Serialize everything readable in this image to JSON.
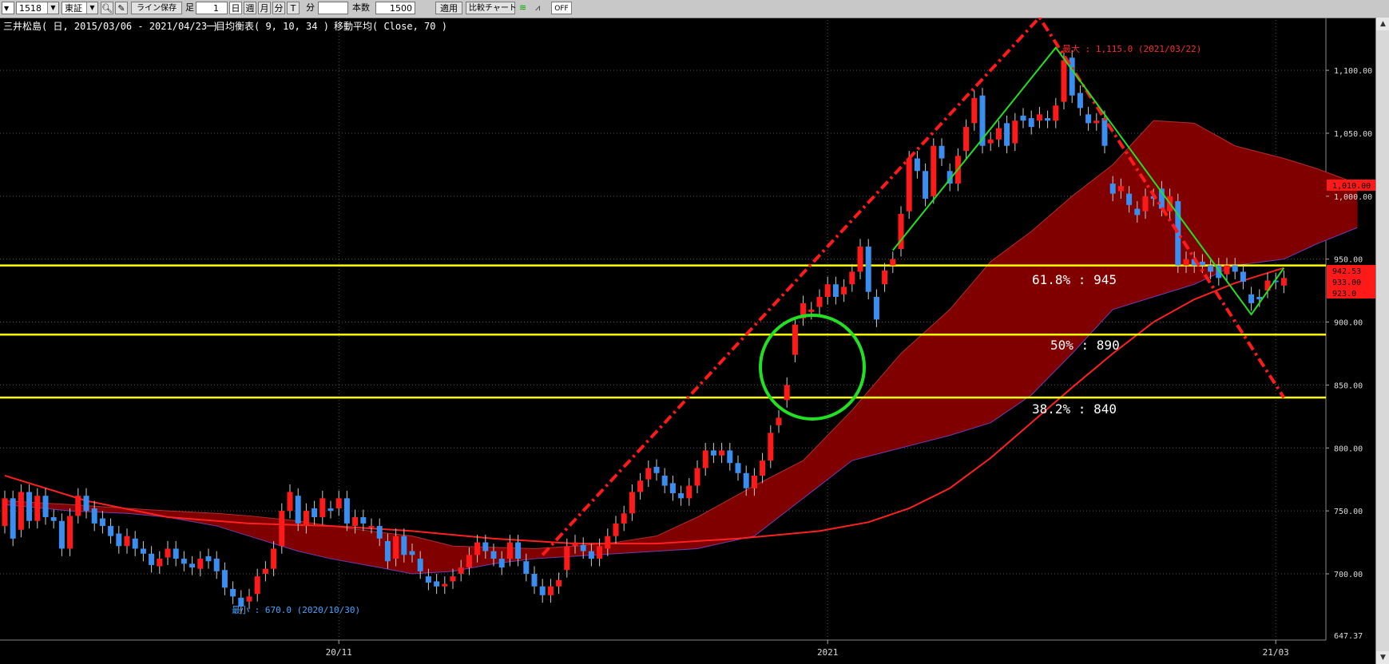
{
  "toolbar": {
    "code": "1518",
    "exchange": "東証",
    "save_label": "ライン保存",
    "ashi_label": "足",
    "period_value": "1",
    "day_label": "日",
    "week_label": "週",
    "month_label": "月",
    "minute_label": "分",
    "tick_label": "T",
    "minute2_label": "分",
    "count_label": "本数",
    "count_value": "1500",
    "apply_label": "適用",
    "compare_label": "比較チャート",
    "off_label": "OFF"
  },
  "header": {
    "title": "三井松島( 日, 2015/03/06 - 2021/04/23 )",
    "ichimoku": "一目均衡表( 9, 10, 34 )",
    "ma": "移動平均( Close, 70 )"
  },
  "annotations": {
    "max": "最大 : 1,115.0 (2021/03/22)",
    "min": "最小 : 670.0 (2020/10/30)",
    "fib618": "61.8% : 945",
    "fib50": "50% : 890",
    "fib382": "38.2% : 840"
  },
  "price_tags": {
    "a": "1,010.00",
    "b": "942.53",
    "c": "933.00",
    "d": "923.0"
  },
  "colors": {
    "up": "#ff1a1a",
    "down": "#3a8ef0",
    "yellow": "#ffff00",
    "green": "#22e022",
    "red_line": "#ff1a1a",
    "kumo_red": "#800000",
    "kumo_blue": "#1c1c95",
    "grid": "#555555",
    "ma": "#ff2020"
  },
  "chart_data": {
    "type": "candlestick",
    "ylim": [
      647.37,
      1140
    ],
    "y_ticks": [
      "700.00",
      "750.00",
      "800.00",
      "850.00",
      "900.00",
      "950.00",
      "1,000.00",
      "1,050.00",
      "1,100.00"
    ],
    "y_tick_values": [
      700,
      750,
      800,
      850,
      900,
      950,
      1000,
      1050,
      1100
    ],
    "bottom_label": "647.37",
    "x_labels": [
      {
        "label": "20/11",
        "index": 41
      },
      {
        "label": "2021",
        "index": 101
      },
      {
        "label": "21/03",
        "index": 156
      }
    ],
    "fib_levels": [
      945,
      890,
      840
    ],
    "candles": [
      [
        0,
        738,
        760
      ],
      [
        1,
        760,
        728
      ],
      [
        2,
        735,
        765
      ],
      [
        3,
        765,
        742
      ],
      [
        4,
        742,
        762
      ],
      [
        5,
        762,
        745
      ],
      [
        6,
        745,
        742
      ],
      [
        7,
        742,
        720
      ],
      [
        8,
        720,
        746
      ],
      [
        9,
        746,
        762
      ],
      [
        10,
        762,
        750
      ],
      [
        11,
        752,
        740
      ],
      [
        12,
        744,
        738
      ],
      [
        13,
        738,
        730
      ],
      [
        14,
        732,
        722
      ],
      [
        15,
        722,
        730
      ],
      [
        16,
        728,
        720
      ],
      [
        17,
        720,
        716
      ],
      [
        18,
        716,
        707
      ],
      [
        19,
        706,
        712
      ],
      [
        20,
        713,
        720
      ],
      [
        21,
        720,
        712
      ],
      [
        22,
        712,
        708
      ],
      [
        23,
        708,
        705
      ],
      [
        24,
        704,
        712
      ],
      [
        25,
        714,
        710
      ],
      [
        26,
        712,
        702
      ],
      [
        27,
        703,
        689
      ],
      [
        28,
        688,
        682
      ],
      [
        29,
        681,
        674
      ],
      [
        30,
        678,
        682
      ],
      [
        31,
        684,
        698
      ],
      [
        32,
        700,
        704
      ],
      [
        33,
        704,
        720
      ],
      [
        34,
        722,
        750
      ],
      [
        35,
        750,
        765
      ],
      [
        36,
        762,
        740
      ],
      [
        37,
        738,
        750
      ],
      [
        38,
        752,
        745
      ],
      [
        39,
        745,
        760
      ],
      [
        40,
        752,
        750
      ],
      [
        41,
        752,
        760
      ],
      [
        42,
        760,
        740
      ],
      [
        43,
        738,
        745
      ],
      [
        44,
        745,
        740
      ],
      [
        45,
        738,
        738
      ],
      [
        46,
        738,
        728
      ],
      [
        47,
        726,
        710
      ],
      [
        48,
        712,
        730
      ],
      [
        49,
        730,
        715
      ],
      [
        50,
        718,
        715
      ],
      [
        51,
        712,
        702
      ],
      [
        52,
        698,
        693
      ],
      [
        53,
        694,
        690
      ],
      [
        54,
        690,
        692
      ],
      [
        55,
        694,
        698
      ],
      [
        56,
        700,
        705
      ],
      [
        57,
        705,
        715
      ],
      [
        58,
        715,
        725
      ],
      [
        59,
        725,
        718
      ],
      [
        60,
        718,
        712
      ],
      [
        61,
        712,
        705
      ],
      [
        62,
        712,
        725
      ],
      [
        63,
        725,
        712
      ],
      [
        64,
        710,
        700
      ],
      [
        65,
        700,
        690
      ],
      [
        66,
        690,
        683
      ],
      [
        67,
        683,
        690
      ],
      [
        68,
        690,
        695
      ],
      [
        69,
        703,
        722
      ],
      [
        70,
        722,
        725
      ],
      [
        71,
        723,
        718
      ],
      [
        72,
        718,
        712
      ],
      [
        73,
        712,
        722
      ],
      [
        74,
        720,
        730
      ],
      [
        75,
        730,
        740
      ],
      [
        76,
        740,
        748
      ],
      [
        77,
        748,
        765
      ],
      [
        78,
        765,
        774
      ],
      [
        79,
        775,
        784
      ],
      [
        80,
        785,
        780
      ],
      [
        81,
        778,
        770
      ],
      [
        82,
        772,
        764
      ],
      [
        83,
        764,
        760
      ],
      [
        84,
        760,
        770
      ],
      [
        85,
        770,
        784
      ],
      [
        86,
        784,
        798
      ],
      [
        87,
        798,
        794
      ],
      [
        88,
        794,
        798
      ],
      [
        89,
        798,
        788
      ],
      [
        90,
        788,
        780
      ],
      [
        91,
        780,
        768
      ],
      [
        92,
        768,
        778
      ],
      [
        93,
        778,
        790
      ],
      [
        94,
        790,
        812
      ],
      [
        95,
        818,
        824
      ],
      [
        96,
        838,
        850
      ],
      [
        97,
        874,
        898
      ],
      [
        98,
        903,
        915
      ],
      [
        99,
        908,
        910
      ],
      [
        100,
        912,
        920
      ],
      [
        101,
        920,
        930
      ],
      [
        102,
        930,
        920
      ],
      [
        103,
        922,
        928
      ],
      [
        104,
        930,
        940
      ],
      [
        105,
        940,
        960
      ],
      [
        106,
        960,
        924
      ],
      [
        107,
        920,
        902
      ],
      [
        108,
        930,
        941
      ],
      [
        109,
        945,
        950
      ],
      [
        110,
        958,
        986
      ],
      [
        111,
        988,
        1030
      ],
      [
        112,
        1030,
        1020
      ],
      [
        113,
        1020,
        998
      ],
      [
        114,
        1000,
        1040
      ],
      [
        115,
        1040,
        1030
      ],
      [
        116,
        1020,
        1010
      ],
      [
        117,
        1010,
        1032
      ],
      [
        118,
        1036,
        1055
      ],
      [
        119,
        1058,
        1078
      ],
      [
        120,
        1080,
        1040
      ],
      [
        121,
        1042,
        1045
      ],
      [
        122,
        1045,
        1054
      ],
      [
        123,
        1058,
        1040
      ],
      [
        124,
        1042,
        1060
      ],
      [
        125,
        1064,
        1060
      ],
      [
        126,
        1062,
        1055
      ],
      [
        127,
        1060,
        1065
      ],
      [
        128,
        1062,
        1060
      ],
      [
        129,
        1060,
        1072
      ],
      [
        130,
        1075,
        1108
      ],
      [
        131,
        1110,
        1080
      ],
      [
        132,
        1082,
        1070
      ],
      [
        133,
        1065,
        1058
      ],
      [
        134,
        1058,
        1060
      ],
      [
        135,
        1062,
        1040
      ],
      [
        136,
        1010,
        1002
      ],
      [
        137,
        1004,
        1008
      ],
      [
        138,
        1002,
        993
      ],
      [
        139,
        990,
        985
      ],
      [
        140,
        988,
        1000
      ],
      [
        141,
        1000,
        998
      ],
      [
        142,
        1006,
        990
      ],
      [
        143,
        988,
        1000
      ],
      [
        144,
        996,
        945
      ],
      [
        145,
        945,
        950
      ],
      [
        146,
        950,
        945
      ],
      [
        147,
        948,
        945
      ],
      [
        148,
        945,
        940
      ],
      [
        149,
        945,
        935
      ],
      [
        150,
        938,
        945
      ],
      [
        151,
        945,
        940
      ],
      [
        152,
        940,
        932
      ],
      [
        153,
        922,
        915
      ],
      [
        154,
        920,
        918
      ],
      [
        155,
        925,
        933
      ],
      [
        156,
        933,
        932
      ],
      [
        157,
        929,
        935
      ]
    ],
    "ma70": [
      [
        0,
        778
      ],
      [
        10,
        758
      ],
      [
        20,
        745
      ],
      [
        30,
        740
      ],
      [
        40,
        738
      ],
      [
        50,
        734
      ],
      [
        60,
        728
      ],
      [
        70,
        724
      ],
      [
        80,
        724
      ],
      [
        90,
        728
      ],
      [
        100,
        734
      ],
      [
        106,
        741
      ],
      [
        111,
        752
      ],
      [
        116,
        768
      ],
      [
        121,
        792
      ],
      [
        126,
        820
      ],
      [
        131,
        848
      ],
      [
        136,
        875
      ],
      [
        141,
        900
      ],
      [
        146,
        918
      ],
      [
        151,
        931
      ],
      [
        157,
        943
      ]
    ],
    "kumo_lead1": [
      [
        0,
        758
      ],
      [
        8,
        755
      ],
      [
        15,
        752
      ],
      [
        20,
        750
      ],
      [
        26,
        748
      ],
      [
        30,
        746
      ],
      [
        36,
        742
      ],
      [
        40,
        738
      ],
      [
        46,
        733
      ],
      [
        50,
        730
      ],
      [
        55,
        722
      ],
      [
        60,
        721
      ],
      [
        65,
        720
      ],
      [
        70,
        722
      ],
      [
        75,
        725
      ],
      [
        80,
        730
      ],
      [
        85,
        745
      ],
      [
        92,
        770
      ],
      [
        98,
        790
      ],
      [
        104,
        830
      ],
      [
        110,
        875
      ],
      [
        116,
        910
      ],
      [
        121,
        948
      ],
      [
        126,
        972
      ],
      [
        131,
        1000
      ],
      [
        136,
        1025
      ],
      [
        141,
        1060
      ],
      [
        146,
        1058
      ],
      [
        151,
        1040
      ],
      [
        157,
        1030
      ],
      [
        161,
        1022
      ],
      [
        166,
        1010
      ]
    ],
    "kumo_lead2": [
      [
        0,
        755
      ],
      [
        8,
        750
      ],
      [
        15,
        748
      ],
      [
        20,
        745
      ],
      [
        26,
        738
      ],
      [
        30,
        730
      ],
      [
        36,
        718
      ],
      [
        40,
        712
      ],
      [
        46,
        705
      ],
      [
        50,
        700
      ],
      [
        55,
        702
      ],
      [
        60,
        708
      ],
      [
        65,
        712
      ],
      [
        70,
        714
      ],
      [
        75,
        716
      ],
      [
        80,
        718
      ],
      [
        85,
        720
      ],
      [
        92,
        730
      ],
      [
        98,
        760
      ],
      [
        104,
        790
      ],
      [
        110,
        800
      ],
      [
        116,
        810
      ],
      [
        121,
        820
      ],
      [
        126,
        842
      ],
      [
        131,
        875
      ],
      [
        136,
        910
      ],
      [
        141,
        920
      ],
      [
        146,
        930
      ],
      [
        151,
        945
      ],
      [
        157,
        950
      ],
      [
        161,
        962
      ],
      [
        166,
        975
      ]
    ]
  }
}
